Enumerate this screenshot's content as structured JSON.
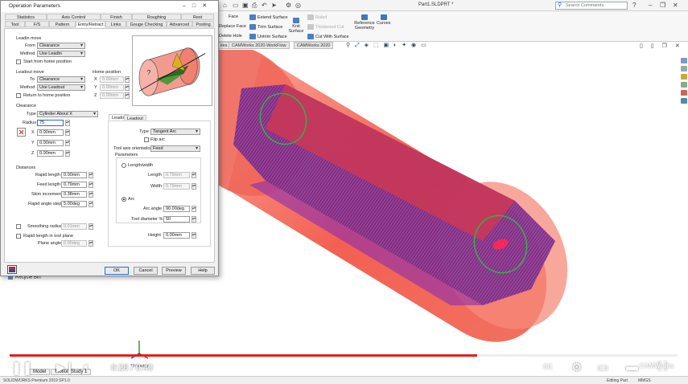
{
  "app": {
    "document_title": "Part1.SLDPRT *",
    "search_placeholder": "Search Commands",
    "ribbon_items": [
      {
        "label": "Face"
      },
      {
        "label": "Extend Surface"
      },
      {
        "label": "Ruled"
      },
      {
        "label": "Reference Geometry"
      },
      {
        "label": "Curves"
      },
      {
        "label": "Replace Face"
      },
      {
        "label": "Trim Surface"
      },
      {
        "label": "Knit Surface"
      },
      {
        "label": "Thickened Cut"
      },
      {
        "label": "Delete Hole"
      },
      {
        "label": "Untrim Surface"
      },
      {
        "label": "Cut With Surface"
      }
    ],
    "doc_tabs": [
      {
        "label": "ites"
      },
      {
        "label": "CAMWorks 2020-WorkFlow"
      },
      {
        "label": "CAMWorks 2020"
      }
    ],
    "recycle_bin": "Recycle Bin",
    "bottom_tabs": [
      {
        "label": "Model"
      },
      {
        "label": "Motion Study 1"
      }
    ],
    "projection_label": "*Trimetric",
    "status_left": "SOLIDWORKS Premium 2019 SP1.0",
    "status_editing": "Editing Part",
    "status_units": "MMGS"
  },
  "colors": {
    "stock": "#f25a4a",
    "part_body": "#6a2c8c",
    "toolpath": "#c03a9a",
    "accent_blue": "#2a6ad6",
    "progress_red": "#e62117"
  },
  "video": {
    "current_time": "0:28",
    "duration": "0:40",
    "progress": 0.7,
    "watermark": "CAMWorks"
  },
  "dialog": {
    "title": "Operation Parameters",
    "tabs_row1": [
      {
        "label": "Statistics"
      },
      {
        "label": "Axis Control"
      },
      {
        "label": "Finish"
      },
      {
        "label": "Roughing"
      },
      {
        "label": "Rest"
      }
    ],
    "tabs_row2": [
      {
        "label": "Tool"
      },
      {
        "label": "F/S"
      },
      {
        "label": "Pattern"
      },
      {
        "label": "Entry/Retract"
      },
      {
        "label": "Links"
      },
      {
        "label": "Gouge Checking"
      },
      {
        "label": "Advanced"
      },
      {
        "label": "Posting"
      }
    ],
    "active_tab": "Entry/Retract",
    "leadin_move": {
      "title": "Leadin move",
      "from_label": "From",
      "from_value": "Clearance",
      "method_label": "Method",
      "method_value": "Use Leadin",
      "start_home_label": "Start from home position"
    },
    "leadout_move": {
      "title": "Leadout move",
      "to_label": "To",
      "to_value": "Clearance",
      "method_label": "Method",
      "method_value": "Use Leadout",
      "return_home_label": "Return to home position"
    },
    "home_position": {
      "title": "Home position",
      "x_label": "X",
      "x_value": "0.00mm",
      "y_label": "Y",
      "y_value": "0.00mm",
      "z_label": "Z",
      "z_value": "0.00mm"
    },
    "clearance": {
      "title": "Clearance",
      "type_label": "Type",
      "type_value": "Cylinder About X",
      "radius_label": "Radius",
      "radius_value": "75",
      "x_label": "X",
      "x_value": "0.00mm",
      "y_label": "Y",
      "y_value": "0.00mm",
      "z_label": "Z",
      "z_value": "0.00mm"
    },
    "distances": {
      "title": "Distances",
      "rapid_length_label": "Rapid length",
      "rapid_length_value": "0.00mm",
      "feed_length_label": "Feed length",
      "feed_length_value": "0.79mm",
      "skim_increment_label": "Skim increment",
      "skim_increment_value": "0.38mm",
      "rapid_angle_step_label": "Rapid angle step",
      "rapid_angle_step_value": "5.00deg",
      "smoothing_radius_label": "Smoothing radius",
      "smoothing_radius_value": "0.01mm",
      "rapid_tool_plane_label": "Rapid length in tool plane",
      "plane_angle_label": "Plane angle",
      "plane_angle_value": "0.00deg"
    },
    "leadin_panel": {
      "tab_leadin": "Leadin",
      "tab_leadout": "Leadout",
      "type_label": "Type",
      "type_value": "Tangent Arc",
      "flip_arc_label": "Flip arc",
      "tool_axis_label": "Tool axis orientation",
      "tool_axis_value": "Feed",
      "parameters_title": "Parameters",
      "length_width_label": "Length/width",
      "length_label": "Length",
      "length_value": "0.79mm",
      "width_label": "Width",
      "width_value": "0.79mm",
      "arc_label": "Arc",
      "arc_angle_label": "Arc angle",
      "arc_angle_value": "90.00deg",
      "tool_diameter_label": "Tool diameter %",
      "tool_diameter_value": "50",
      "height_label": "Height",
      "height_value": "0.00mm"
    },
    "buttons": {
      "ok": "OK",
      "cancel": "Cancel",
      "preview": "Preview",
      "help": "Help"
    }
  }
}
